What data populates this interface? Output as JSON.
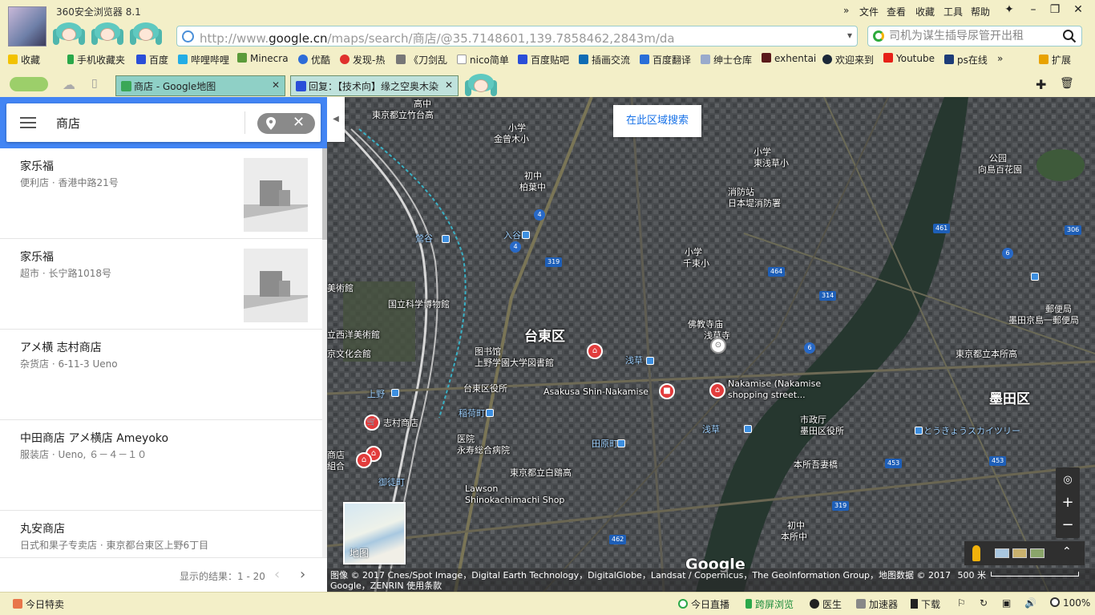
{
  "browser": {
    "title": "360安全浏览器 8.1",
    "menus": [
      "文件",
      "查看",
      "收藏",
      "工具",
      "帮助"
    ],
    "address": {
      "prefix": "http://www.",
      "domain": "google.cn",
      "path": "/maps/search/商店/@35.7148601,139.7858462,2843m/da"
    },
    "search_placeholder": "司机为谋生插导尿管开出租",
    "bookmarks": [
      "收藏",
      "手机收藏夹",
      "百度",
      "哔哩哔哩",
      "Minecra",
      "优酷",
      "发现-热",
      "《刀剑乱",
      "nico简单",
      "百度贴吧",
      "插画交流",
      "百度翻译",
      "绅士仓库",
      "exhentai",
      "欢迎来到",
      "Youtube",
      "ps在线",
      "扩展"
    ],
    "tabs": [
      {
        "label": "商店 - Google地图"
      },
      {
        "label": "回复：【技术向】缘之空奥木染"
      }
    ]
  },
  "panel": {
    "query": "商店",
    "results": [
      {
        "name": "家乐福",
        "detail": "便利店 · 香港中路21号",
        "has_thumb": true
      },
      {
        "name": "家乐福",
        "detail": "超市 · 长宁路1018号",
        "has_thumb": true
      },
      {
        "name": "アメ横 志村商店",
        "detail": "杂货店 · 6-11-3 Ueno",
        "has_thumb": false
      },
      {
        "name": "中田商店 アメ横店 Ameyoko",
        "detail": "服装店 · Ueno, ６－４－１０",
        "has_thumb": false
      },
      {
        "name": "丸安商店",
        "detail": "日式和果子专卖店 · 東京都台東区上野6丁目",
        "has_thumb": false
      }
    ],
    "pager": "显示的结果：1 - 20"
  },
  "map": {
    "search_area_button": "在此区域搜索",
    "minimap_label": "地图",
    "attribution": "图像 © 2017 Cnes/Spot Image，Digital Earth Technology，DigitalGlobe，Landsat / Copernicus，The GeoInformation Group，地图数据 © 2017 Google，ZENRIN    使用条款",
    "scale": "500 米",
    "google": "Google",
    "labels": {
      "taito": "台東区",
      "sumida": "墨田区",
      "asakusa_temple": "佛教寺庙",
      "asakusa_temple_sub": "浅草寺",
      "nakamise": "Nakamise (Nakamise",
      "nakamise_sub": "shopping street...",
      "shin_nakamise": "Asakusa Shin-Nakamise",
      "shimura": "志村商店",
      "lawson": "Lawson",
      "lawson_sub": "Shinokachimachi Shop",
      "museum": "国立科学博物館",
      "library": "图书馆",
      "library_sub": "上野学園大学図書館",
      "ward_office": "台東区役所",
      "hospital": "医院",
      "hospital_sub": "永寿総合病院",
      "school1": "東京都立竹台高",
      "school2": "金曾木小",
      "school3": "柏葉中",
      "school4": "東浅草小",
      "fire": "消防站",
      "fire_sub": "日本堤消防署",
      "school5": "千束小",
      "school6": "東京都立白鴎高",
      "asakusa": "浅草",
      "tawaramachi": "田原町",
      "city_office": "市政厅",
      "city_office_sub": "墨田区役所",
      "post": "郵便局",
      "post_sub": "墨田京島一郵便局",
      "sumida_school": "東京都立本所高",
      "park": "公园",
      "park_sub": "向島百花園",
      "skytree": "とうきょうスカイツリー",
      "ueno": "上野",
      "uguisudani": "鶯谷",
      "iriya": "入谷",
      "inaricho": "稲荷町",
      "okachimachi": "御徒町",
      "kasuga": "本所吾妻橋",
      "honjo": "本所中",
      "ueno_art": "美術館",
      "western_art": "立西洋美術館",
      "bunka": "京文化会館",
      "nakata": "商店",
      "nakata2": "組合",
      "takanaka": "高中",
      "shogaku": "小学",
      "chugaku": "初中"
    }
  },
  "status": {
    "today_deals": "今日特卖",
    "live": "今日直播",
    "cross_screen": "跨屏浏览",
    "doctor": "医生",
    "accelerator": "加速器",
    "download": "下载",
    "zoom": "100%"
  }
}
